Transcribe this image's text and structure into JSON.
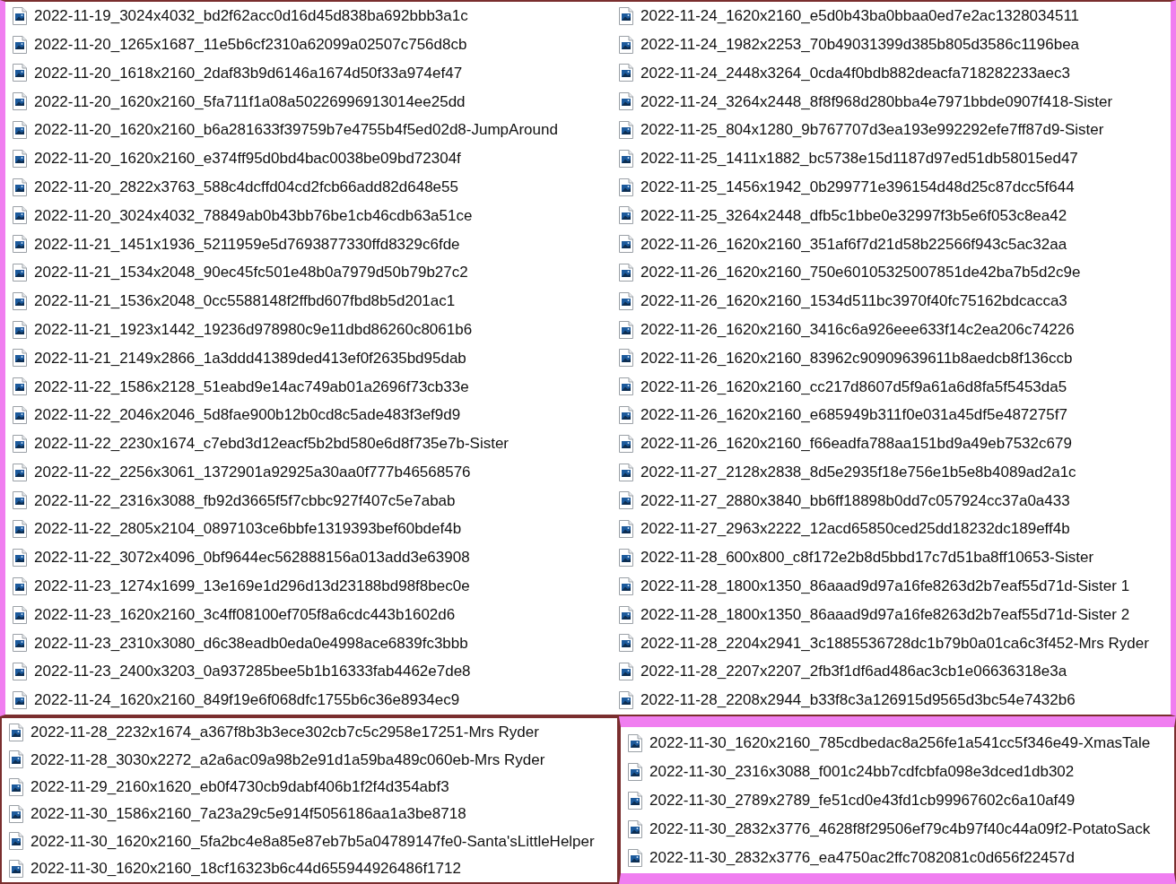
{
  "top_panel": {
    "columns": [
      {
        "files": [
          "2022-11-19_3024x4032_bd2f62acc0d16d45d838ba692bbb3a1c",
          "2022-11-20_1265x1687_11e5b6cf2310a62099a02507c756d8cb",
          "2022-11-20_1618x2160_2daf83b9d6146a1674d50f33a974ef47",
          "2022-11-20_1620x2160_5fa711f1a08a50226996913014ee25dd",
          "2022-11-20_1620x2160_b6a281633f39759b7e4755b4f5ed02d8-JumpAround",
          "2022-11-20_1620x2160_e374ff95d0bd4bac0038be09bd72304f",
          "2022-11-20_2822x3763_588c4dcffd04cd2fcb66add82d648e55",
          "2022-11-20_3024x4032_78849ab0b43bb76be1cb46cdb63a51ce",
          "2022-11-21_1451x1936_5211959e5d7693877330ffd8329c6fde",
          "2022-11-21_1534x2048_90ec45fc501e48b0a7979d50b79b27c2",
          "2022-11-21_1536x2048_0cc5588148f2ffbd607fbd8b5d201ac1",
          "2022-11-21_1923x1442_19236d978980c9e11dbd86260c8061b6",
          "2022-11-21_2149x2866_1a3ddd41389ded413ef0f2635bd95dab",
          "2022-11-22_1586x2128_51eabd9e14ac749ab01a2696f73cb33e",
          "2022-11-22_2046x2046_5d8fae900b12b0cd8c5ade483f3ef9d9",
          "2022-11-22_2230x1674_c7ebd3d12eacf5b2bd580e6d8f735e7b-Sister",
          "2022-11-22_2256x3061_1372901a92925a30aa0f777b46568576",
          "2022-11-22_2316x3088_fb92d3665f5f7cbbc927f407c5e7abab",
          "2022-11-22_2805x2104_0897103ce6bbfe1319393bef60bdef4b",
          "2022-11-22_3072x4096_0bf9644ec562888156a013add3e63908",
          "2022-11-23_1274x1699_13e169e1d296d13d23188bd98f8bec0e",
          "2022-11-23_1620x2160_3c4ff08100ef705f8a6cdc443b1602d6",
          "2022-11-23_2310x3080_d6c38eadb0eda0e4998ace6839fc3bbb",
          "2022-11-23_2400x3203_0a937285bee5b1b16333fab4462e7de8",
          "2022-11-24_1620x2160_849f19e6f068dfc1755b6c36e8934ec9"
        ]
      },
      {
        "files": [
          "2022-11-24_1620x2160_e5d0b43ba0bbaa0ed7e2ac1328034511",
          "2022-11-24_1982x2253_70b49031399d385b805d3586c1196bea",
          "2022-11-24_2448x3264_0cda4f0bdb882deacfa718282233aec3",
          "2022-11-24_3264x2448_8f8f968d280bba4e7971bbde0907f418-Sister",
          "2022-11-25_804x1280_9b767707d3ea193e992292efe7ff87d9-Sister",
          "2022-11-25_1411x1882_bc5738e15d1187d97ed51db58015ed47",
          "2022-11-25_1456x1942_0b299771e396154d48d25c87dcc5f644",
          "2022-11-25_3264x2448_dfb5c1bbe0e32997f3b5e6f053c8ea42",
          "2022-11-26_1620x2160_351af6f7d21d58b22566f943c5ac32aa",
          "2022-11-26_1620x2160_750e60105325007851de42ba7b5d2c9e",
          "2022-11-26_1620x2160_1534d511bc3970f40fc75162bdcacca3",
          "2022-11-26_1620x2160_3416c6a926eee633f14c2ea206c74226",
          "2022-11-26_1620x2160_83962c90909639611b8aedcb8f136ccb",
          "2022-11-26_1620x2160_cc217d8607d5f9a61a6d8fa5f5453da5",
          "2022-11-26_1620x2160_e685949b311f0e031a45df5e487275f7",
          "2022-11-26_1620x2160_f66eadfa788aa151bd9a49eb7532c679",
          "2022-11-27_2128x2838_8d5e2935f18e756e1b5e8b4089ad2a1c",
          "2022-11-27_2880x3840_bb6ff18898b0dd7c057924cc37a0a433",
          "2022-11-27_2963x2222_12acd65850ced25dd18232dc189eff4b",
          "2022-11-28_600x800_c8f172e2b8d5bbd17c7d51ba8ff10653-Sister",
          "2022-11-28_1800x1350_86aaad9d97a16fe8263d2b7eaf55d71d-Sister 1",
          "2022-11-28_1800x1350_86aaad9d97a16fe8263d2b7eaf55d71d-Sister 2",
          "2022-11-28_2204x2941_3c1885536728dc1b79b0a01ca6c3f452-Mrs Ryder",
          "2022-11-28_2207x2207_2fb3f1df6ad486ac3cb1e06636318e3a",
          "2022-11-28_2208x2944_b33f8c3a126915d9565d3bc54e7432b6"
        ]
      }
    ]
  },
  "bottom_left_panel": {
    "files": [
      "2022-11-28_2232x1674_a367f8b3b3ece302cb7c5c2958e17251-Mrs Ryder",
      "2022-11-28_3030x2272_a2a6ac09a98b2e91d1a59ba489c060eb-Mrs Ryder",
      "2022-11-29_2160x1620_eb0f4730cb9dabf406b1f2f4d354abf3",
      "2022-11-30_1586x2160_7a23a29c5e914f5056186aa1a3be8718",
      "2022-11-30_1620x2160_5fa2bc4e8a85e87eb7b5a04789147fe0-Santa'sLittleHelper",
      "2022-11-30_1620x2160_18cf16323b6c44d655944926486f1712"
    ]
  },
  "bottom_right_panel": {
    "files": [
      "2022-11-30_1620x2160_785cdbedac8a256fe1a541cc5f346e49-XmasTale",
      "2022-11-30_2316x3088_f001c24bb7cdfcbfa098e3dced1db302",
      "2022-11-30_2789x2789_fe51cd0e43fd1cb99967602c6a10af49",
      "2022-11-30_2832x3776_4628f8f29506ef79c4b97f40c44a09f2-PotatoSack",
      "2022-11-30_2832x3776_ea4750ac2ffc7082081c0d656f22457d"
    ]
  }
}
